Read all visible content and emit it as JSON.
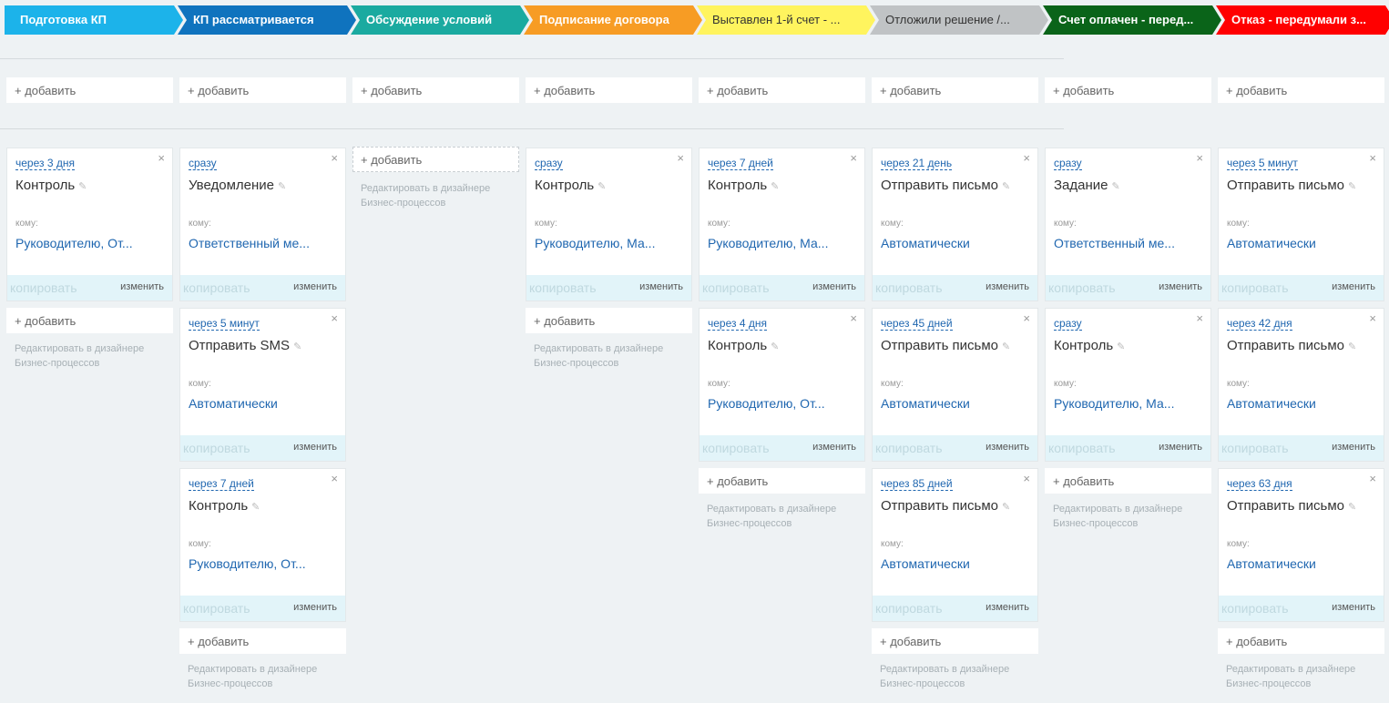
{
  "stages": [
    {
      "label": "Подготовка КП",
      "color": "#1cb3ea"
    },
    {
      "label": "КП рассматривается",
      "color": "#0f73be"
    },
    {
      "label": "Обсуждение условий",
      "color": "#1aaaa0"
    },
    {
      "label": "Подписание договора",
      "color": "#f79c24"
    },
    {
      "label": "Выставлен 1-й счет - ...",
      "color": "#fff45e"
    },
    {
      "label": "Отложили решение /...",
      "color": "#c0c3c5"
    },
    {
      "label": "Счет оплачен - перед...",
      "color": "#0a6419"
    },
    {
      "label": "Отказ - передумали з...",
      "color": "#ff0000"
    }
  ],
  "common": {
    "add_label": "+ добавить",
    "to_label": "кому:",
    "copy_label": "копировать",
    "edit_label": "изменить",
    "close_glyph": "×",
    "pencil_glyph": "✎",
    "hint_line1": "Редактировать в дизайнере",
    "hint_line2": "Бизнес-процессов"
  },
  "columns": [
    {
      "cards": [
        {
          "delay": "через 3 дня",
          "title": "Контроль",
          "to": "Руководителю, От..."
        }
      ]
    },
    {
      "cards": [
        {
          "delay": "сразу",
          "title": "Уведомление",
          "to": "Ответственный ме..."
        },
        {
          "delay": "через 5 минут",
          "title": "Отправить SMS",
          "to": "Автоматически"
        },
        {
          "delay": "через 7 дней",
          "title": "Контроль",
          "to": "Руководителю, От..."
        }
      ]
    },
    {
      "cards": []
    },
    {
      "cards": [
        {
          "delay": "сразу",
          "title": "Контроль",
          "to": "Руководителю, Ма..."
        }
      ]
    },
    {
      "cards": [
        {
          "delay": "через 7 дней",
          "title": "Контроль",
          "to": "Руководителю, Ма..."
        },
        {
          "delay": "через 4 дня",
          "title": "Контроль",
          "to": "Руководителю, От..."
        }
      ]
    },
    {
      "cards": [
        {
          "delay": "через 21 день",
          "title": "Отправить письмо",
          "to": "Автоматически"
        },
        {
          "delay": "через 45 дней",
          "title": "Отправить письмо",
          "to": "Автоматически"
        },
        {
          "delay": "через 85 дней",
          "title": "Отправить письмо",
          "to": "Автоматически"
        }
      ]
    },
    {
      "cards": [
        {
          "delay": "сразу",
          "title": "Задание",
          "to": "Ответственный ме..."
        },
        {
          "delay": "сразу",
          "title": "Контроль",
          "to": "Руководителю, Ма..."
        }
      ]
    },
    {
      "cards": [
        {
          "delay": "через 5 минут",
          "title": "Отправить письмо",
          "to": "Автоматически"
        },
        {
          "delay": "через 42 дня",
          "title": "Отправить письмо",
          "to": "Автоматически"
        },
        {
          "delay": "через 63 дня",
          "title": "Отправить письмо",
          "to": "Автоматически"
        }
      ]
    }
  ]
}
